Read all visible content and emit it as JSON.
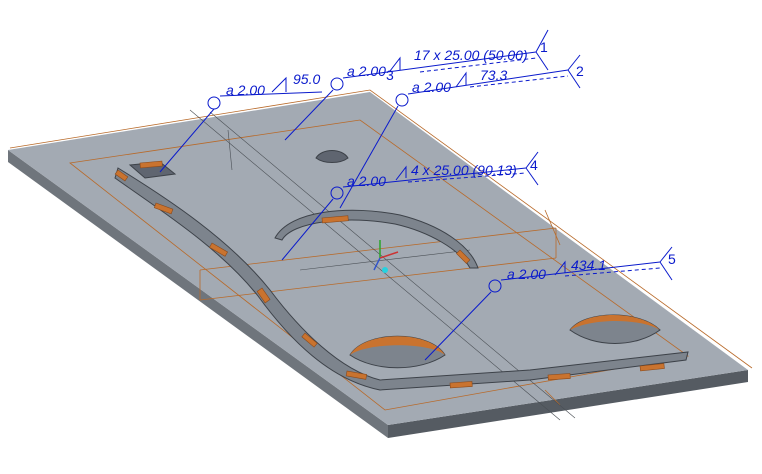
{
  "viewport": {
    "background": "#ffffff",
    "plate_top_color": "#a3aab3",
    "plate_edge_color": "#6f757c",
    "cut_color": "#c9732f",
    "weld_color": "#0a1acc",
    "outline_color": "#b86a2a"
  },
  "welds": [
    {
      "id": "1",
      "size": "a 2.00",
      "length": "17 x 25.00 (50.00)"
    },
    {
      "id": "2",
      "size": "a 2.00",
      "length": "73.3"
    },
    {
      "id": "3",
      "size": "a 2.00",
      "length": "95.0"
    },
    {
      "id": "4",
      "size": "a 2.00",
      "length": "4 x 25.00 (90.13)"
    },
    {
      "id": "5",
      "size": "a 2.00",
      "length": "434.1"
    }
  ]
}
